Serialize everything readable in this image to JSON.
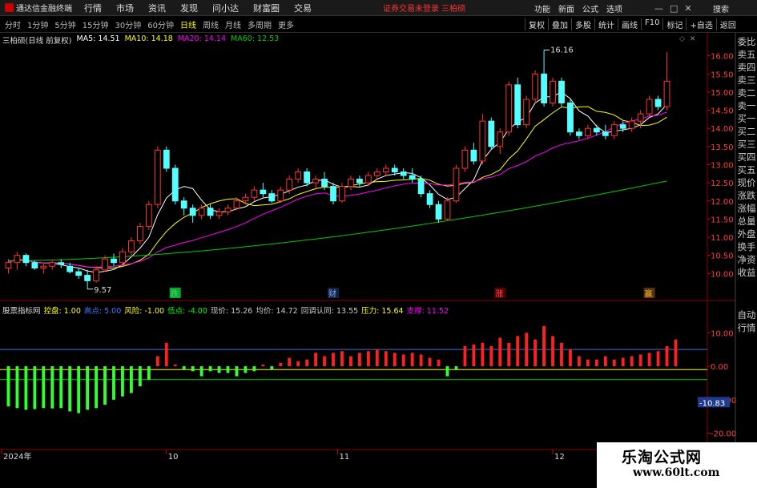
{
  "app": {
    "title": "通达信金融终端"
  },
  "menu": [
    "行情",
    "市场",
    "资讯",
    "发现",
    "问小达",
    "财富圈",
    "交易"
  ],
  "notice": "证券交易未登录  三柏硕",
  "right_menu": [
    "功能",
    "新面",
    "公式",
    "选项"
  ],
  "search": "搜索",
  "periods": [
    "分时",
    "1分钟",
    "5分钟",
    "15分钟",
    "30分钟",
    "60分钟",
    "日线",
    "周线",
    "月线",
    "多周期",
    "更多"
  ],
  "active_period": "日线",
  "tools": [
    "复权",
    "叠加",
    "多股",
    "统计",
    "画线",
    "F10",
    "标记",
    "+自选",
    "返回"
  ],
  "legend_main": {
    "name": "三柏硕(日线 前复权)",
    "ma5": "MA5: 14.51",
    "ma10": "MA10: 14.18",
    "ma20": "MA20: 14.14",
    "ma60": "MA60: 12.53"
  },
  "legend_ind": {
    "name": "股票指标网",
    "items": [
      "控盘: 1.00",
      "高点: 5.00",
      "风险: -1.00",
      "低点: -4.00",
      "现价: 15.26",
      "均价: 14.72",
      "回调认同: 13.55",
      "压力: 15.64",
      "支撑: 11.52"
    ]
  },
  "right_panel": [
    "委比",
    "卖五",
    "卖四",
    "卖三",
    "卖二",
    "卖一",
    "买一",
    "买二",
    "买三",
    "买四",
    "买五",
    "现价",
    "涨跌",
    "涨幅",
    "总量",
    "外盘",
    "换手",
    "净资",
    "收益"
  ],
  "right_panel2": [
    "自动",
    "行情"
  ],
  "watermark": {
    "line1": "乐淘公式网",
    "line2": "www.60lt.com"
  },
  "colors": {
    "up": "#ff3232",
    "down": "#54ffff",
    "ma5": "#ffffff",
    "ma10": "#ffff00",
    "ma20": "#ff00ff",
    "ma60": "#00cc00"
  },
  "chart_data": [
    {
      "type": "candlestick",
      "title": "三柏硕(日线 前复权)",
      "ylim": [
        9.3,
        16.5
      ],
      "yticks": [
        10.0,
        10.5,
        11.0,
        11.5,
        12.0,
        12.5,
        13.0,
        13.5,
        14.0,
        14.5,
        15.0,
        15.5,
        16.0
      ],
      "x_labels": [
        "2024年",
        "10",
        "11",
        "12"
      ],
      "annotations": [
        "16.16",
        "9.57"
      ],
      "markers": [
        "跌",
        "财",
        "涨",
        "赢"
      ],
      "ohlc": [
        [
          10.15,
          10.4,
          10.0,
          10.3
        ],
        [
          10.3,
          10.6,
          10.1,
          10.5
        ],
        [
          10.5,
          10.55,
          10.2,
          10.3
        ],
        [
          10.3,
          10.35,
          10.1,
          10.15
        ],
        [
          10.15,
          10.3,
          10.0,
          10.2
        ],
        [
          10.2,
          10.35,
          10.1,
          10.3
        ],
        [
          10.3,
          10.4,
          10.15,
          10.25
        ],
        [
          10.2,
          10.3,
          10.0,
          10.05
        ],
        [
          10.05,
          10.15,
          9.85,
          9.95
        ],
        [
          9.95,
          10.1,
          9.57,
          9.8
        ],
        [
          9.8,
          10.2,
          9.75,
          10.1
        ],
        [
          10.1,
          10.5,
          10.05,
          10.4
        ],
        [
          10.4,
          10.55,
          10.2,
          10.3
        ],
        [
          10.3,
          10.7,
          10.25,
          10.6
        ],
        [
          10.6,
          11.0,
          10.5,
          10.9
        ],
        [
          10.9,
          11.4,
          10.8,
          11.3
        ],
        [
          11.3,
          12.0,
          11.2,
          11.9
        ],
        [
          11.9,
          13.5,
          11.8,
          13.4
        ],
        [
          13.4,
          13.5,
          12.8,
          12.9
        ],
        [
          12.9,
          13.0,
          11.9,
          12.0
        ],
        [
          12.0,
          12.1,
          11.6,
          11.8
        ],
        [
          11.8,
          11.9,
          11.4,
          11.6
        ],
        [
          11.6,
          11.9,
          11.5,
          11.8
        ],
        [
          11.8,
          11.9,
          11.5,
          11.6
        ],
        [
          11.6,
          11.8,
          11.5,
          11.7
        ],
        [
          11.7,
          11.9,
          11.6,
          11.8
        ],
        [
          11.8,
          12.1,
          11.75,
          12.0
        ],
        [
          12.0,
          12.2,
          11.9,
          12.1
        ],
        [
          12.1,
          12.4,
          12.0,
          12.3
        ],
        [
          12.3,
          12.5,
          12.1,
          12.2
        ],
        [
          12.2,
          12.3,
          11.95,
          12.0
        ],
        [
          12.0,
          12.4,
          11.95,
          12.3
        ],
        [
          12.3,
          12.7,
          12.2,
          12.6
        ],
        [
          12.6,
          12.9,
          12.5,
          12.8
        ],
        [
          12.8,
          12.9,
          12.4,
          12.5
        ],
        [
          12.5,
          12.7,
          12.3,
          12.6
        ],
        [
          12.6,
          12.8,
          12.3,
          12.4
        ],
        [
          12.4,
          12.5,
          11.9,
          12.0
        ],
        [
          12.0,
          12.5,
          11.95,
          12.4
        ],
        [
          12.4,
          12.7,
          12.3,
          12.6
        ],
        [
          12.6,
          12.7,
          12.4,
          12.5
        ],
        [
          12.5,
          12.8,
          12.4,
          12.7
        ],
        [
          12.7,
          12.9,
          12.6,
          12.8
        ],
        [
          12.8,
          13.0,
          12.7,
          12.9
        ],
        [
          12.9,
          13.0,
          12.7,
          12.8
        ],
        [
          12.8,
          12.9,
          12.6,
          12.7
        ],
        [
          12.7,
          12.9,
          12.5,
          12.6
        ],
        [
          12.6,
          12.7,
          12.1,
          12.2
        ],
        [
          12.2,
          12.3,
          11.8,
          11.9
        ],
        [
          11.9,
          12.0,
          11.4,
          11.5
        ],
        [
          11.5,
          12.1,
          11.45,
          12.0
        ],
        [
          12.0,
          13.0,
          11.95,
          12.9
        ],
        [
          12.9,
          13.5,
          12.8,
          13.4
        ],
        [
          13.4,
          13.6,
          13.0,
          13.1
        ],
        [
          13.1,
          14.4,
          13.0,
          14.2
        ],
        [
          14.2,
          14.3,
          13.4,
          13.5
        ],
        [
          13.5,
          14.0,
          13.3,
          13.9
        ],
        [
          13.9,
          15.3,
          13.8,
          15.2
        ],
        [
          15.2,
          15.4,
          14.0,
          14.1
        ],
        [
          14.1,
          14.9,
          14.0,
          14.8
        ],
        [
          14.8,
          15.6,
          14.7,
          15.5
        ],
        [
          15.5,
          16.16,
          14.6,
          14.7
        ],
        [
          14.7,
          15.4,
          14.6,
          15.3
        ],
        [
          15.3,
          15.4,
          14.6,
          14.7
        ],
        [
          14.7,
          14.8,
          13.8,
          13.9
        ],
        [
          13.9,
          14.0,
          13.7,
          13.8
        ],
        [
          13.8,
          14.1,
          13.7,
          14.0
        ],
        [
          14.0,
          14.1,
          13.8,
          13.9
        ],
        [
          13.9,
          14.1,
          13.7,
          13.8
        ],
        [
          13.8,
          14.2,
          13.7,
          14.1
        ],
        [
          14.1,
          14.2,
          13.9,
          14.0
        ],
        [
          14.0,
          14.3,
          13.9,
          14.2
        ],
        [
          14.2,
          14.5,
          14.0,
          14.4
        ],
        [
          14.4,
          14.9,
          14.3,
          14.8
        ],
        [
          14.8,
          14.9,
          14.5,
          14.6
        ],
        [
          14.6,
          16.1,
          14.5,
          15.3
        ]
      ],
      "series": [
        {
          "name": "MA5"
        },
        {
          "name": "MA10"
        },
        {
          "name": "MA20"
        },
        {
          "name": "MA60"
        }
      ]
    },
    {
      "type": "bar",
      "title": "股票指标网",
      "ylim": [
        -22,
        17
      ],
      "yticks": [
        10.0,
        0.0,
        -10.0,
        -20.0
      ],
      "annotations": [
        "-10.83"
      ],
      "lines": [
        {
          "name": "高点",
          "value": 5.0
        },
        {
          "name": "风险",
          "value": -1.0
        },
        {
          "name": "低点",
          "value": -4.0
        }
      ],
      "values": [
        -12,
        -12.5,
        -13,
        -12.8,
        -12.5,
        -12.6,
        -12.5,
        -13.5,
        -14,
        -13,
        -12.5,
        -11.5,
        -10,
        -9,
        -8,
        -6,
        -4,
        3,
        7,
        0.5,
        -1,
        -1.5,
        -3,
        -1.5,
        -2,
        -2,
        -3,
        -2,
        -1.5,
        0.5,
        -1,
        1,
        2.5,
        1.5,
        2,
        4,
        3,
        4,
        4.5,
        3,
        4,
        4.5,
        5,
        4.5,
        4,
        3.5,
        4,
        3.5,
        2.5,
        2,
        -3,
        -1,
        6,
        6.5,
        7,
        6,
        8.5,
        7,
        9,
        10,
        8,
        12,
        9,
        7,
        5,
        3,
        2,
        2,
        3,
        2,
        2.5,
        3,
        3.5,
        4,
        4.5,
        6,
        8
      ]
    }
  ]
}
